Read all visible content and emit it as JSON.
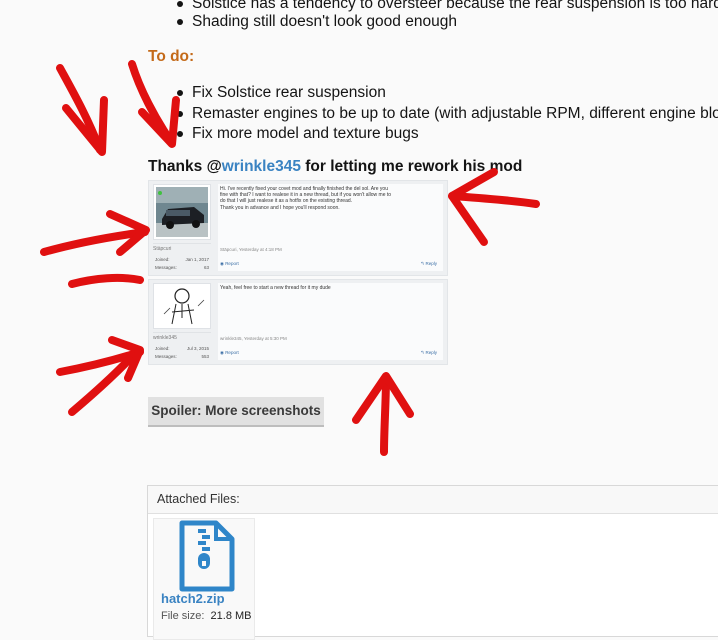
{
  "top_bullets": [
    "Solstice has a tendency to oversteer because the rear suspension is too hard",
    "Shading still doesn't look good enough"
  ],
  "todo": {
    "heading": "To do:",
    "items": [
      "Fix Solstice rear suspension",
      "Remaster engines to be up to date (with adjustable RPM, different engine blo",
      "Fix more model and texture bugs"
    ]
  },
  "thanks": {
    "prefix": "Thanks @",
    "user": "wrinkle345",
    "suffix": " for letting me rework his mod"
  },
  "posts": [
    {
      "username": "Stäpcuri",
      "joined_label": "Joined:",
      "joined": "Jan 1, 2017",
      "messages_label": "Messages:",
      "messages": "63",
      "message_lines": [
        "Hi. I've recently fixed your covet mod and finally finished the del sol. Are you",
        "fine with that? I want to realese it in a new thread, but if you won't allow me to",
        "do that I will just realese it as a hotfix on the existing thread.",
        "Thank you in advance and I hope you'll respond soon."
      ],
      "signature": "Stäpcuri, Yesterday at 4:18 PM",
      "report": "Report",
      "reply": "Reply"
    },
    {
      "username": "wrinkle345",
      "joined_label": "Joined:",
      "joined": "Jul 3, 2015",
      "messages_label": "Messages:",
      "messages": "553",
      "message_lines": [
        "Yeah, feel free to start a new thread for it my dude"
      ],
      "signature": "wrinkle345, Yesterday at 5:30 PM",
      "report": "Report",
      "reply": "Reply"
    }
  ],
  "spoiler_label": "Spoiler: More screenshots",
  "attachments": {
    "header": "Attached Files:",
    "file_name": "hatch2.zip",
    "file_size_label": "File size:",
    "file_size": "21.8 MB",
    "icon": "zip-file-icon"
  },
  "colors": {
    "link": "#3a83c2",
    "todo": "#c46a19",
    "arrows": "#e01010"
  }
}
